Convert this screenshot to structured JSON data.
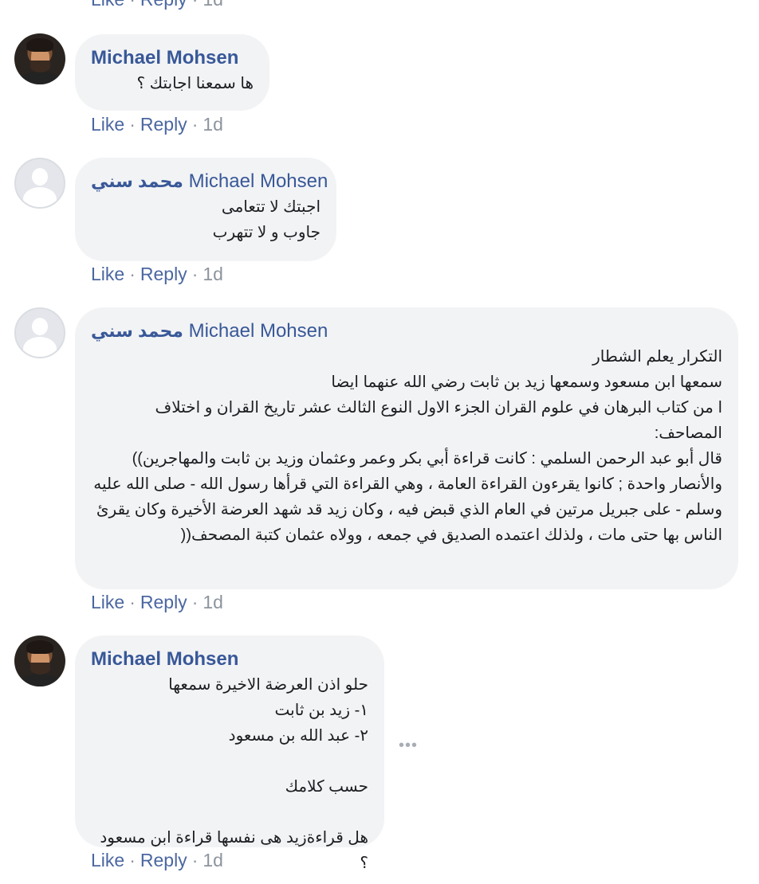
{
  "actions": {
    "like": "Like",
    "reply": "Reply",
    "separator": "·",
    "time": "1d"
  },
  "comments": [
    {
      "author": "Michael Mohsen",
      "message": "ها سمعنا اجابتك ؟",
      "avatar": "profile-photo"
    },
    {
      "mention": "محمد سني",
      "author": "Michael Mohsen",
      "message": "اجبتك لا تتعامى\nجاوب و لا تتهرب",
      "avatar": "default-silhouette"
    },
    {
      "mention": "محمد سني",
      "author": "Michael Mohsen",
      "message": "التكرار يعلم الشطار\nسمعها ابن مسعود وسمعها زيد بن ثابت رضي الله عنهما ايضا\nا من كتاب البرهان في علوم القران الجزء الاول النوع الثالث عشر تاريخ القران و اختلاف المصاحف:\nقال أبو عبد الرحمن السلمي : كانت قراءة أبي بكر وعمر وعثمان وزيد بن ثابت والمهاجرين)) والأنصار واحدة ; كانوا يقرءون القراءة العامة ، وهي القراءة التي قرأها رسول الله - صلى الله عليه وسلم - على جبريل مرتين في العام الذي قبض فيه ، وكان زيد قد شهد العرضة الأخيرة وكان يقرئ الناس بها حتى مات ، ولذلك اعتمده الصديق في جمعه ، وولاه عثمان كتبة المصحف((",
      "avatar": "default-silhouette"
    },
    {
      "author": "Michael Mohsen",
      "message": "حلو اذن العرضة الاخيرة سمعها\n١- زيد بن ثابت\n٢- عبد الله بن مسعود\n\nحسب كلامك\n\nهل قراءةزيد هى نفسها قراءة ابن مسعود ؟",
      "avatar": "profile-photo"
    }
  ],
  "more_icon": "more-options-icon",
  "more_glyph": "•••"
}
